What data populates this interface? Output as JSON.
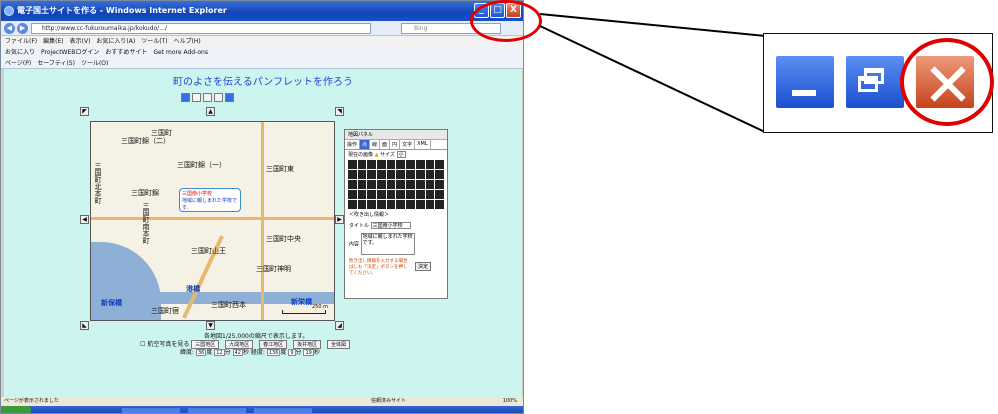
{
  "browser": {
    "title": "電子国土サイトを作る - Windows Internet Explorer",
    "url": "http://www.cc-fukuroumaika.jp/kokudo/.../",
    "search_placeholder": "Bing",
    "menu": [
      "ファイル(F)",
      "編集(E)",
      "表示(V)",
      "お気に入り(A)",
      "ツール(T)",
      "ヘルプ(H)"
    ],
    "favorites": [
      "お気に入り",
      "ProjectWEBログイン",
      "おすすめサイト",
      "Get more Add-ons"
    ],
    "commands": [
      "ページ(P)",
      "セーフティ(S)",
      "ツール(O)"
    ],
    "window_buttons": {
      "minimize": "_",
      "maximize": "□",
      "close": "X"
    }
  },
  "page": {
    "title": "町のよさを伝えるパンフレットを作ろう",
    "map_labels": [
      "三国町",
      "三国町錦（二）",
      "三国町錦（一）",
      "三国町錦",
      "三国町北本町",
      "三国町南本町",
      "三国町山王",
      "三国町東",
      "三国町中央",
      "港橋",
      "新保橋",
      "新栄橋",
      "三国町宿",
      "三国町西本",
      "三国町神明"
    ],
    "callout": {
      "title": "三国南小学校",
      "body": "地域に親しまれた学校です。"
    },
    "scale_label": "250 m",
    "panel": {
      "header": "地図パネル",
      "tabs": [
        "操作",
        "点",
        "線",
        "面",
        "円",
        "文字",
        "XML"
      ],
      "current_symbol_label": "現在の画像",
      "size_label": "サイズ",
      "size_value": "小",
      "balloon_label": "＜吹き出し情報＞",
      "title_label": "タイトル",
      "title_value": "三国南小学校",
      "content_label": "内容",
      "content_value": "地域に親しまれた学校です。",
      "notice": "吹き出し情報を入力する場合はしも「決定」ボタンを押してください。",
      "decide_button": "決定"
    },
    "footer": {
      "scale_text": "各地図1/25,000の縮尺で表示します。",
      "aerial_checkbox": "航空写真を見る",
      "area_buttons": [
        "三国地区",
        "九間地区",
        "春江地区",
        "坂井地区",
        "全体図"
      ],
      "lat_label": "緯度:",
      "lat_deg": "36",
      "lat_min": "12",
      "lat_sec": "42",
      "lon_label": "経度:",
      "lon_deg": "136",
      "lon_min": "9",
      "lon_sec": "19",
      "deg_unit": "度",
      "min_unit": "分",
      "sec_unit": "秒"
    }
  },
  "statusbar": {
    "left": "ページが表示されました",
    "zone": "信頼済みサイト",
    "zoom": "100%"
  },
  "colors": {
    "highlight": "#e00000",
    "page_bg": "#ccf5f0",
    "title_blue": "#2244cc"
  }
}
